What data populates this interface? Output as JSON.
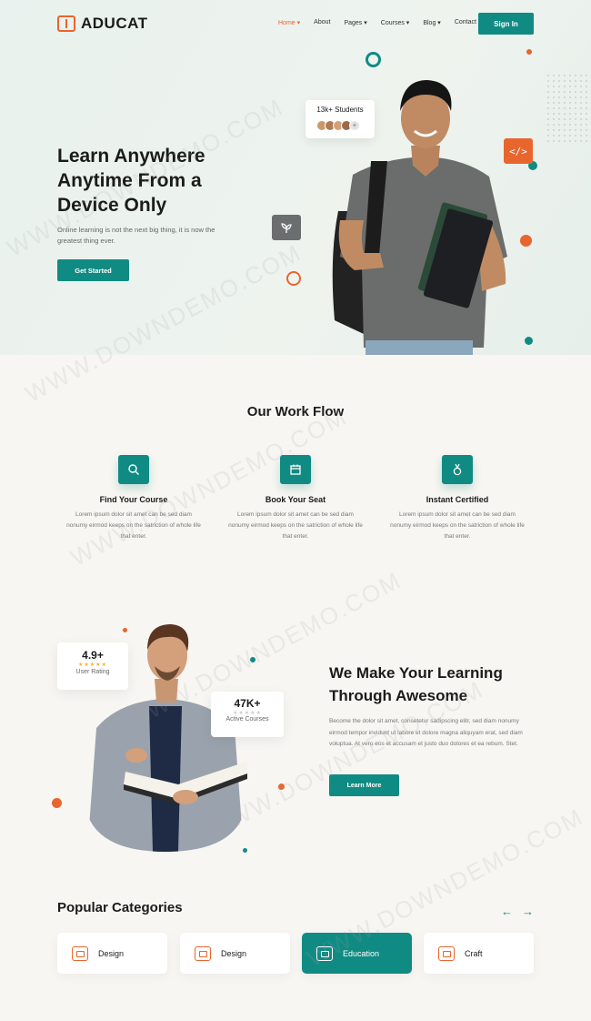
{
  "header": {
    "brand": "ADUCAT",
    "nav": [
      {
        "label": "Home",
        "active": true
      },
      {
        "label": "About"
      },
      {
        "label": "Pages"
      },
      {
        "label": "Courses"
      },
      {
        "label": "Blog"
      },
      {
        "label": "Contact"
      }
    ],
    "signin_label": "Sign In"
  },
  "hero": {
    "title_lines": [
      "Learn Anywhere",
      "Anytime From a",
      "Device Only"
    ],
    "subtitle": "Online learning is not the next big thing, it is now the greatest thing ever.",
    "cta_label": "Get Started",
    "students_badge": "13k+ Students",
    "code_icon_glyph": "</>"
  },
  "workflow": {
    "title": "Our Work Flow",
    "steps": [
      {
        "icon": "search-icon",
        "title": "Find Your Course",
        "text": "Lorem ipsum dolor sit amet can be sed diam nonumy eirmod keeps on the satriction of whole life that enter."
      },
      {
        "icon": "calendar-icon",
        "title": "Book Your Seat",
        "text": "Lorem ipsum dolor sit amet can be sed diam nonumy eirmod keeps on the satriction of whole life that enter."
      },
      {
        "icon": "medal-icon",
        "title": "Instant Certified",
        "text": "Lorem ipsum dolor sit amet can be sed diam nonumy eirmod keeps on the satriction of whole life that enter."
      }
    ]
  },
  "learning": {
    "rating_value": "4.9+",
    "rating_label": "User Rating",
    "courses_value": "47K+",
    "courses_label": "Active Courses",
    "title_lines": [
      "We Make Your Learning",
      "Through Awesome"
    ],
    "text": "Become the dolor sit amet, consetetur sadipscing elitr, sed diam nonumy eirmod tempor invidunt ut labore et dolore magna aliquyam erat, sed diam voluptua. At vero eos et accusam et justo duo dolores et ea rebum. Stet.",
    "cta_label": "Learn More"
  },
  "categories": {
    "title": "Popular Categories",
    "items": [
      {
        "label": "Design",
        "active": false
      },
      {
        "label": "Design",
        "active": false
      },
      {
        "label": "Education",
        "active": true
      },
      {
        "label": "Craft",
        "active": false
      }
    ]
  },
  "colors": {
    "teal": "#108b83",
    "orange": "#e8652d",
    "text": "#1b1b1b"
  },
  "watermark": "WWW.DOWNDEMO.COM"
}
